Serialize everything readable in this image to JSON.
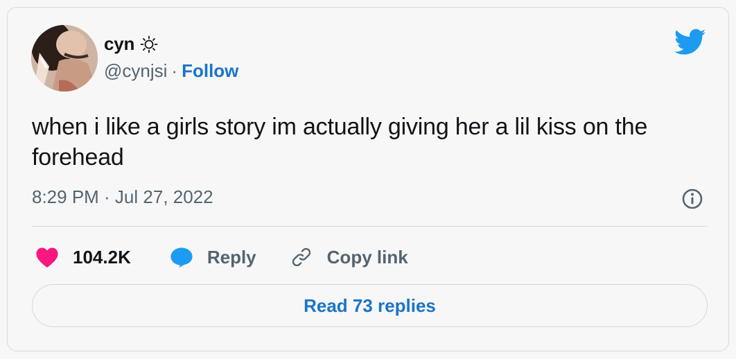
{
  "author": {
    "display_name": "cyn",
    "name_emoji_icon": "sun-icon",
    "handle": "@cynjsi",
    "separator": "·",
    "follow_label": "Follow"
  },
  "tweet": {
    "text": "when i like a girls story im actually giving her a lil kiss on the forehead",
    "timestamp": "8:29 PM · Jul 27, 2022"
  },
  "actions": {
    "like_count": "104.2K",
    "reply_label": "Reply",
    "copy_link_label": "Copy link"
  },
  "read_replies_label": "Read 73 replies",
  "colors": {
    "twitter_blue": "#1d9bf0",
    "link_blue": "#1a74c9",
    "heart_pink": "#f91880",
    "text_primary": "#0f1419",
    "text_secondary": "#536471",
    "border": "#d6dadd"
  }
}
